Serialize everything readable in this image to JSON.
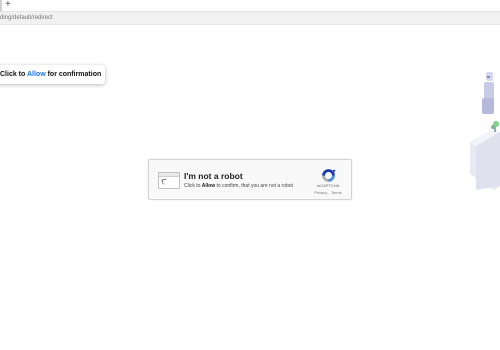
{
  "browser": {
    "new_tab_label": "+",
    "url": "ding/default/redirect"
  },
  "prompt": {
    "text_before": "Click to ",
    "allow_word": "Allow",
    "text_after": " for confirmation",
    "accent_color": "#1a73e8"
  },
  "captcha": {
    "title": "I'm not a robot",
    "sub_before": "Click to ",
    "sub_bold": "Allow",
    "sub_after": " to confirm, that you are not a robot",
    "brand": "reCAPTCHA",
    "privacy": "Privacy",
    "separator": " - ",
    "terms": "Terms",
    "logo_icon": "recaptcha-logo-icon"
  },
  "illustration": {
    "icon": "robot-illustration-icon"
  }
}
